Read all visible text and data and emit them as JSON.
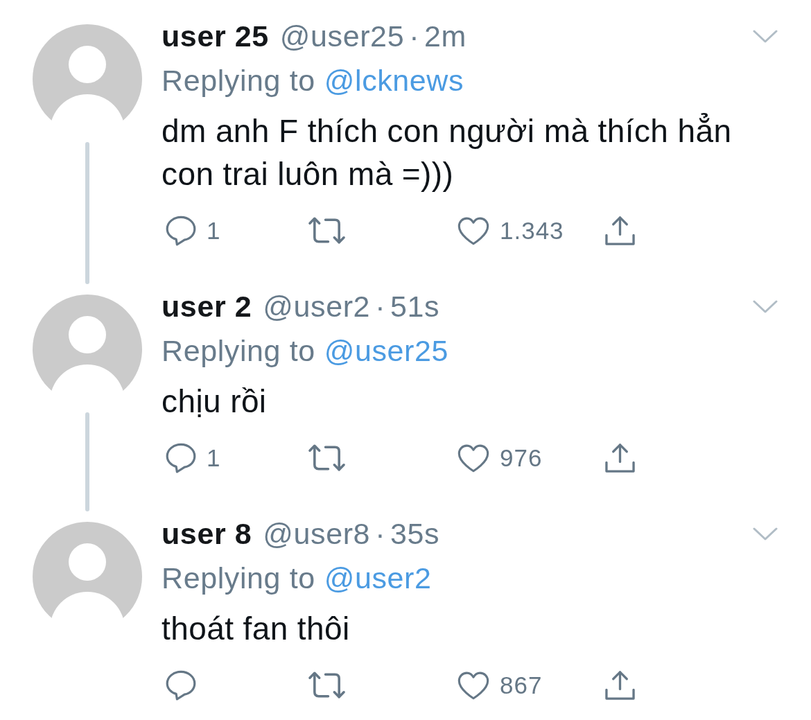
{
  "tweets": [
    {
      "name": "user 25",
      "handle": "@user25",
      "separator": "·",
      "time": "2m",
      "reply_label": "Replying to",
      "reply_to": "@lcknews",
      "text": "dm anh F thích con người mà thích hẳn con trai luôn mà =)))",
      "replies": "1",
      "likes": "1.343",
      "thread_line": true
    },
    {
      "name": "user 2",
      "handle": "@user2",
      "separator": "·",
      "time": "51s",
      "reply_label": "Replying to",
      "reply_to": "@user25",
      "text": "chịu rồi",
      "replies": "1",
      "likes": "976",
      "thread_line": true
    },
    {
      "name": "user 8",
      "handle": "@user8",
      "separator": "·",
      "time": "35s",
      "reply_label": "Replying to",
      "reply_to": "@user2",
      "text": "thoát fan thôi",
      "likes": "867",
      "thread_line": false
    }
  ]
}
